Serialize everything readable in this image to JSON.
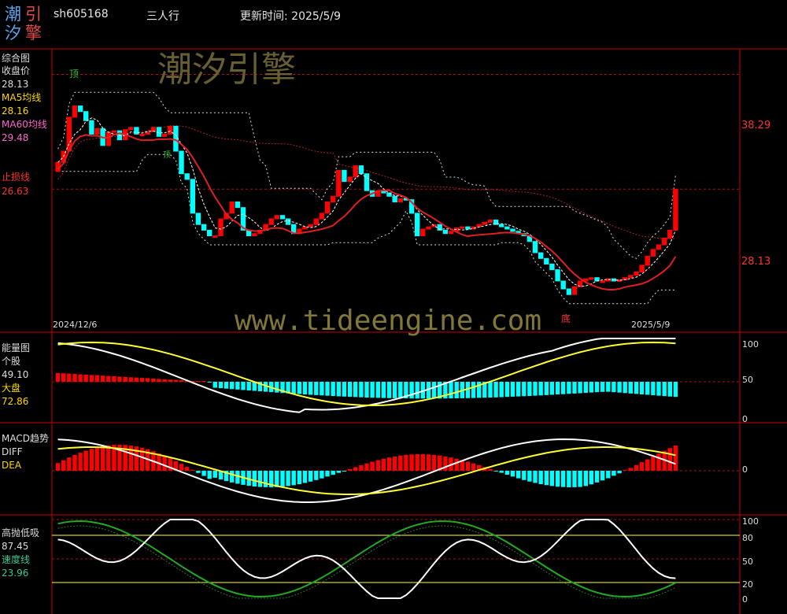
{
  "header": {
    "logo": {
      "c1": "潮",
      "c2": "引",
      "c3": "汐",
      "c4": "擎"
    },
    "code": "sh605168",
    "name": "三人行",
    "update": "更新时间: 2025/5/9"
  },
  "watermark": {
    "cn": "潮汐引擎",
    "url": "www.tideengine.com"
  },
  "colors": {
    "up": "#ff0000",
    "down": "#00ffff",
    "ma5": "#ffffff",
    "ma60": "#ff3333",
    "stop": "#e02020",
    "ribbon": "#aa2233",
    "white": "#ffffff",
    "yellow": "#ffff33",
    "green": "#22aa22",
    "gridline": "#aa1111",
    "frame": "#cc0000",
    "text_white": "#dddddd",
    "text_yellow": "#ffd700",
    "text_pink": "#ff66cc",
    "text_red": "#ff3333",
    "text_green": "#33cc99",
    "label_green": "#33bb33"
  },
  "panels": {
    "main": {
      "title": "综合图",
      "close_label": "收盘价",
      "close": "28.13",
      "ma5_label": "MA5均线",
      "ma5": "28.16",
      "ma60_label": "MA60均线",
      "ma60": "29.48",
      "stop_label": "止损线",
      "stop": "26.63",
      "axis_hi": "38.29",
      "axis_last": "28.13",
      "top_tag": "顶",
      "bottom_tag": "底",
      "mid_tag": "顶",
      "date_start": "2024/12/6",
      "date_end": "2025/5/9"
    },
    "energy": {
      "title": "能量图",
      "sub": "个股",
      "stock_val": "49.10",
      "mkt_label": "大盘",
      "mkt_val": "72.86",
      "ticks": [
        "100",
        "50",
        "0"
      ]
    },
    "macd": {
      "title": "MACD趋势",
      "diff_label": "DIFF",
      "dea_label": "DEA",
      "zero": "0"
    },
    "osc": {
      "title": "高抛低吸",
      "value": "87.45",
      "speed_label": "速度线",
      "speed": "23.96",
      "ticks": [
        "100",
        "80",
        "50",
        "20",
        "0"
      ]
    }
  },
  "chart_data": [
    {
      "type": "candlestick",
      "title": "综合图",
      "x_range": [
        "2024/12/6",
        "2025/5/9"
      ],
      "ylim": [
        22,
        40
      ],
      "reference_lines": [
        38.29,
        28.13
      ],
      "series": [
        {
          "name": "收盘价",
          "close": [
            30.5,
            31.5,
            34.5,
            35.5,
            35.0,
            34.2,
            33.0,
            33.5,
            32.0,
            33.2,
            33.3,
            32.5,
            33.4,
            33.6,
            33.0,
            33.0,
            33.2,
            33.6,
            32.8,
            33.0,
            33.7,
            31.5,
            29.5,
            29.0,
            26.0,
            25.0,
            24.5,
            24.0,
            24.0,
            25.5,
            26.0,
            27.0,
            26.5,
            24.5,
            24.0,
            24.2,
            24.5,
            25.0,
            25.5,
            25.8,
            25.5,
            25.0,
            24.2,
            24.6,
            24.8,
            25.0,
            25.5,
            26.0,
            27.0,
            27.5,
            29.8,
            28.8,
            29.2,
            30.2,
            29.5,
            28.0,
            27.5,
            28.0,
            27.8,
            27.5,
            27.0,
            27.3,
            27.2,
            26.0,
            24.0,
            24.6,
            24.8,
            25.0,
            24.5,
            24.2,
            24.4,
            24.7,
            24.8,
            24.6,
            24.8,
            25.0,
            25.2,
            25.4,
            25.0,
            24.8,
            24.6,
            24.4,
            24.2,
            24.0,
            23.5,
            22.5,
            22.0,
            21.5,
            21.0,
            20.0,
            19.3,
            18.8,
            19.5,
            20.0,
            20.2,
            20.3,
            20.0,
            20.0,
            20.2,
            20.0,
            20.1,
            20.3,
            20.5,
            20.8,
            21.4,
            22.2,
            22.8,
            23.2,
            23.8,
            24.5,
            28.13
          ]
        },
        {
          "name": "MA5均线",
          "last": 28.16
        },
        {
          "name": "MA60均线",
          "last": 29.48
        },
        {
          "name": "止损线",
          "last": 26.63
        }
      ]
    },
    {
      "type": "line",
      "title": "能量图",
      "ylim": [
        0,
        100
      ],
      "series": [
        {
          "name": "个股",
          "last": 49.1
        },
        {
          "name": "大盘",
          "last": 72.86
        }
      ]
    },
    {
      "type": "bar",
      "title": "MACD趋势",
      "series": [
        {
          "name": "DIFF"
        },
        {
          "name": "DEA"
        }
      ]
    },
    {
      "type": "line",
      "title": "高抛低吸",
      "ylim": [
        0,
        100
      ],
      "series": [
        {
          "name": "高抛低吸",
          "last": 87.45
        },
        {
          "name": "速度线",
          "last": 23.96
        }
      ]
    }
  ]
}
